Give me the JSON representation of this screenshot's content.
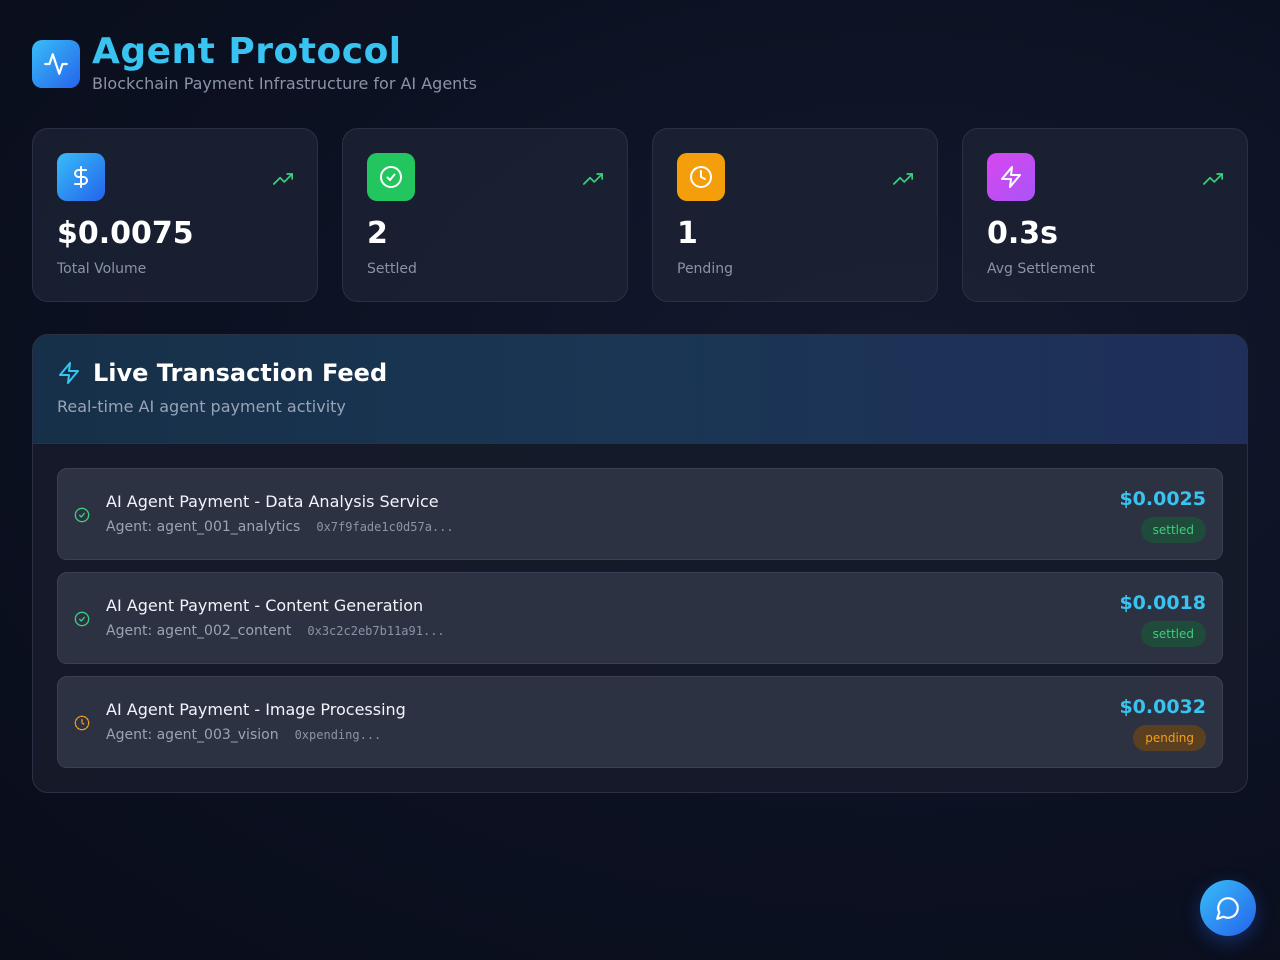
{
  "header": {
    "title": "Agent Protocol",
    "subtitle": "Blockchain Payment Infrastructure for AI Agents",
    "logo_icon": "activity-icon"
  },
  "stats": [
    {
      "value": "$0.0075",
      "label": "Total Volume",
      "icon": "dollar-icon",
      "color": "#2a9df4"
    },
    {
      "value": "2",
      "label": "Settled",
      "icon": "check-circle-icon",
      "color": "#22c55e"
    },
    {
      "value": "1",
      "label": "Pending",
      "icon": "clock-icon",
      "color": "#f59e0b"
    },
    {
      "value": "0.3s",
      "label": "Avg Settlement",
      "icon": "bolt-icon",
      "color": "#c04de0"
    }
  ],
  "feed": {
    "title": "Live Transaction Feed",
    "subtitle": "Real-time AI agent payment activity",
    "transactions": [
      {
        "title": "AI Agent Payment - Data Analysis Service",
        "agent": "Agent: agent_001_analytics",
        "hash": "0x7f9fade1c0d57a...",
        "amount": "$0.0025",
        "status": "settled"
      },
      {
        "title": "AI Agent Payment - Content Generation",
        "agent": "Agent: agent_002_content",
        "hash": "0x3c2c2eb7b11a91...",
        "amount": "$0.0018",
        "status": "settled"
      },
      {
        "title": "AI Agent Payment - Image Processing",
        "agent": "Agent: agent_003_vision",
        "hash": "0xpending...",
        "amount": "$0.0032",
        "status": "pending"
      }
    ]
  },
  "colors": {
    "accent": "#38c3f0",
    "settled": "#3ccf7e",
    "pending": "#f59e1b"
  }
}
